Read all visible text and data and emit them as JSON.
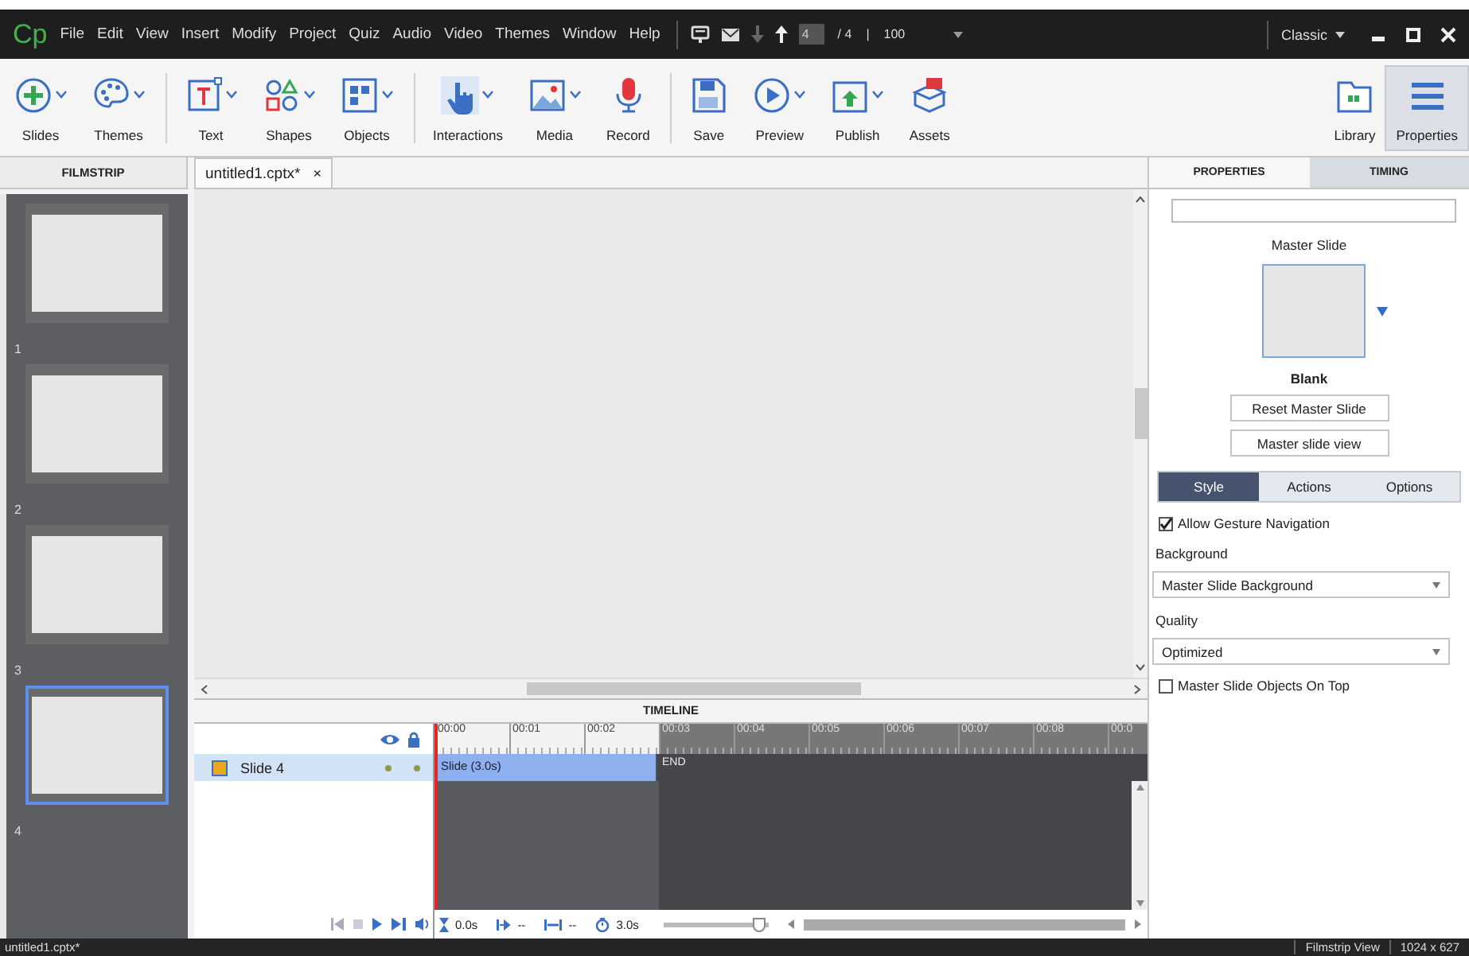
{
  "menu_bar": {
    "logo": "Cp",
    "menus": [
      "File",
      "Edit",
      "View",
      "Insert",
      "Modify",
      "Project",
      "Quiz",
      "Audio",
      "Video",
      "Themes",
      "Window",
      "Help"
    ],
    "slide_field": "4",
    "slide_total": "/ 4",
    "separator": "|",
    "zoom": "100",
    "workspace": "Classic"
  },
  "toolbar": {
    "groups": [
      [
        {
          "label": "Slides",
          "dropdown": true
        },
        {
          "label": "Themes",
          "dropdown": true
        }
      ],
      [
        {
          "label": "Text",
          "dropdown": true
        },
        {
          "label": "Shapes",
          "dropdown": true
        },
        {
          "label": "Objects",
          "dropdown": true
        }
      ],
      [
        {
          "label": "Interactions",
          "dropdown": true
        },
        {
          "label": "Media",
          "dropdown": true
        },
        {
          "label": "Record",
          "dropdown": false
        }
      ],
      [
        {
          "label": "Save",
          "dropdown": false
        },
        {
          "label": "Preview",
          "dropdown": true
        },
        {
          "label": "Publish",
          "dropdown": true
        },
        {
          "label": "Assets",
          "dropdown": false
        }
      ]
    ],
    "panels": [
      {
        "label": "Library",
        "selected": false
      },
      {
        "label": "Properties",
        "selected": true
      }
    ]
  },
  "filmstrip": {
    "title": "FILMSTRIP",
    "slides": [
      {
        "number": "1",
        "selected": false
      },
      {
        "number": "2",
        "selected": false
      },
      {
        "number": "3",
        "selected": false
      },
      {
        "number": "4",
        "selected": true
      }
    ]
  },
  "document_tab": {
    "title": "untitled1.cptx*",
    "close": "×"
  },
  "timeline": {
    "title": "TIMELINE",
    "ticks": [
      "00:00",
      "00:01",
      "00:02",
      "00:03",
      "00:04",
      "00:05",
      "00:06",
      "00:07",
      "00:08",
      "00:0"
    ],
    "rows": [
      {
        "name": "Slide 4",
        "selected": true,
        "bar": "Slide (3.0s)"
      }
    ],
    "end_label": "END",
    "controls": {
      "current_time": "0.0s",
      "start": "--",
      "duration": "--",
      "slide_duration": "3.0s"
    },
    "zoom": {
      "level": 0.9
    }
  },
  "properties": {
    "tabs": [
      {
        "label": "PROPERTIES",
        "selected": true
      },
      {
        "label": "TIMING",
        "selected": false
      }
    ],
    "master_slide_label": "Master Slide",
    "master_name": "Blank",
    "buttons": [
      "Reset Master Slide",
      "Master slide view"
    ],
    "subtabs": [
      {
        "label": "Style",
        "selected": true
      },
      {
        "label": "Actions",
        "selected": false
      },
      {
        "label": "Options",
        "selected": false
      }
    ],
    "gesture": {
      "label": "Allow Gesture Navigation",
      "checked": true
    },
    "background": {
      "label": "Background",
      "value": "Master Slide Background"
    },
    "quality": {
      "label": "Quality",
      "value": "Optimized"
    },
    "objects_on_top": {
      "label": "Master Slide Objects On Top",
      "checked": false
    }
  },
  "status_bar": {
    "file": "untitled1.cptx*",
    "view": "Filmstrip View",
    "size": "1024 x 627"
  }
}
